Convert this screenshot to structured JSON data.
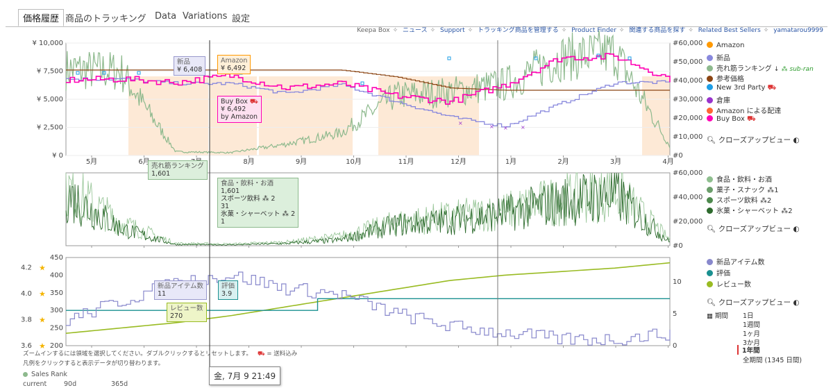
{
  "tabs": [
    "価格履歴",
    "商品のトラッキング",
    "Data",
    "Variations",
    "設定"
  ],
  "top_links": [
    "Keepa Box",
    "ニュース",
    "Support",
    "トラッキング商品を管理する",
    "Product Finder",
    "関連する商品を探す",
    "Related Best Sellers",
    "yamatarou9999"
  ],
  "legend1": {
    "items": [
      {
        "label": "Amazon",
        "color": "#ff9900"
      },
      {
        "label": "新品",
        "color": "#8888dd"
      },
      {
        "label": "売れ筋ランキング",
        "color": "#8db98d"
      },
      {
        "label": "参考価格",
        "color": "#8b4513"
      },
      {
        "label": "New 3rd Party",
        "color": "#1e9ee6"
      },
      {
        "label": "倉庫",
        "color": "#9933cc"
      },
      {
        "label": "Amazon による配達",
        "color": "#ff6633"
      },
      {
        "label": "Buy Box",
        "color": "#ff00b4"
      }
    ],
    "sub_ranking": "sub-ran"
  },
  "legend2": {
    "items": [
      {
        "label": "食品・飲料・お酒",
        "color": "#8fbf8f",
        "suffix": ""
      },
      {
        "label": "菓子・スナック",
        "color": "#6b9e6b",
        "suffix": "1"
      },
      {
        "label": "スポーツ飲料",
        "color": "#4e8a4e",
        "suffix": "2"
      },
      {
        "label": "氷菓・シャーベット",
        "color": "#2e6b2e",
        "suffix": "2"
      }
    ]
  },
  "legend3": {
    "items": [
      {
        "label": "新品アイテム数",
        "color": "#8888cc"
      },
      {
        "label": "評価",
        "color": "#1a9090"
      },
      {
        "label": "レビュー数",
        "color": "#99bb22"
      }
    ]
  },
  "closeup_label": "クローズアップビュー",
  "period": {
    "label": "期間",
    "options": [
      "1日",
      "1週間",
      "1ヶ月",
      "3か月",
      "1年間",
      "全期間 (1345 日間)"
    ],
    "selected": "1年間"
  },
  "tooltips": {
    "new": {
      "title": "新品",
      "value": "¥ 6,408"
    },
    "amazon": {
      "title": "Amazon",
      "value": "¥ 6,492"
    },
    "buybox": {
      "title": "Buy Box",
      "value": "¥ 6,492",
      "sub": "by Amazon"
    },
    "rank": {
      "title": "売れ筋ランキング",
      "value": "1,601"
    },
    "cat": {
      "lines": [
        "食品・飲料・お酒",
        "1,601",
        "スポーツ飲料",
        "31",
        "氷菓・シャーベット",
        "1"
      ]
    },
    "newcount": {
      "title": "新品アイテム数",
      "value": "11"
    },
    "rating": {
      "title": "評価",
      "value": "3.9"
    },
    "reviews": {
      "title": "レビュー数",
      "value": "270"
    }
  },
  "footer": {
    "line1": "ズームインするには領域を選択してください。ダブルクリックするとリセットします。",
    "shipping": "= 送料込み",
    "line2": "凡例をクリックすると表示データが切り替わります。",
    "sales_rank": "Sales Rank",
    "stats": [
      "current",
      "90d",
      "365d"
    ]
  },
  "time_label": "金, 7月 9 21:49",
  "chart_data": [
    {
      "type": "line",
      "title": "価格履歴",
      "x": [
        "5月",
        "6月",
        "7月",
        "8月",
        "9月",
        "10月",
        "11月",
        "12月",
        "1月",
        "2月",
        "3月",
        "4月"
      ],
      "y_left_ticks": [
        "¥ 0",
        "¥ 2,500",
        "¥ 5,000",
        "¥ 7,500",
        "¥ 10,000"
      ],
      "y_right_ticks": [
        "#0",
        "#10,000",
        "#20,000",
        "#30,000",
        "#40,000",
        "#50,000",
        "#60,000"
      ],
      "ylim_left": [
        0,
        10000
      ],
      "ylim_right": [
        0,
        60000
      ],
      "series": [
        {
          "name": "参考価格",
          "values": [
            7600,
            7600,
            7600,
            7600,
            7600,
            7600,
            7000,
            6000,
            5800,
            5800,
            5800,
            5800
          ]
        },
        {
          "name": "Buy Box",
          "values": [
            6700,
            6800,
            6500,
            7100,
            6000,
            6400,
            5300,
            4800,
            6300,
            8700,
            8800,
            6800
          ]
        },
        {
          "name": "新品",
          "values": [
            6800,
            6800,
            6400,
            6400,
            5500,
            6300,
            4800,
            3400,
            2600,
            4600,
            6500,
            6500
          ]
        },
        {
          "name": "売れ筋ランキング",
          "values": [
            46000,
            45000,
            2000,
            1500,
            6000,
            12000,
            32000,
            34000,
            38000,
            52000,
            55000,
            5000
          ]
        }
      ]
    },
    {
      "type": "line",
      "x": [
        "5月",
        "6月",
        "7月",
        "8月",
        "9月",
        "10月",
        "11月",
        "12月",
        "1月",
        "2月",
        "3月",
        "4月"
      ],
      "y_right_ticks": [
        "#0",
        "#20,000",
        "#40,000",
        "#60,000"
      ],
      "ylim": [
        0,
        60000
      ],
      "series": [
        {
          "name": "食品・飲料・お酒",
          "values": [
            50000,
            20000,
            2000,
            1500,
            3000,
            8000,
            20000,
            25000,
            30000,
            40000,
            48000,
            5000
          ]
        },
        {
          "name": "氷菓・シャーベット",
          "values": [
            45000,
            15000,
            1000,
            800,
            2000,
            5000,
            18000,
            22000,
            28000,
            38000,
            45000,
            3000
          ]
        }
      ]
    },
    {
      "type": "line",
      "x": [
        "5月",
        "6月",
        "7月",
        "8月",
        "9月",
        "10月",
        "11月",
        "12月",
        "1月",
        "2月",
        "3月",
        "4月"
      ],
      "y_left_ticks": [
        "200",
        "250",
        "300",
        "350",
        "400",
        "450"
      ],
      "y_rating_ticks": [
        "3.6",
        "3.8",
        "4.0",
        "4.2"
      ],
      "y_right_ticks": [
        "0",
        "5",
        "10"
      ],
      "series": [
        {
          "name": "レビュー数",
          "values": [
            235,
            250,
            265,
            285,
            310,
            335,
            360,
            385,
            400,
            410,
            420,
            435
          ]
        },
        {
          "name": "評価",
          "values": [
            3.9,
            3.9,
            3.9,
            3.9,
            3.9,
            4.0,
            4.0,
            4.0,
            4.0,
            4.0,
            4.0,
            4.0
          ]
        },
        {
          "name": "新品アイテム数",
          "values": [
            4,
            7,
            10,
            11,
            9,
            8,
            5,
            3,
            2,
            1,
            1,
            2
          ]
        }
      ]
    }
  ]
}
